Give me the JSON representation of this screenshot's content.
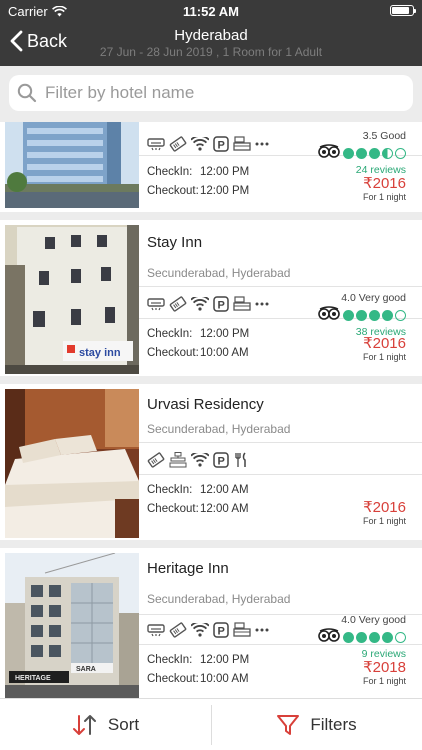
{
  "status": {
    "carrier": "Carrier",
    "time": "11:52 AM",
    "battery_level": 0.85
  },
  "nav": {
    "back_label": "Back",
    "title": "Hyderabad",
    "subtitle": "27 Jun - 28 Jun 2019 , 1 Room for 1 Adult"
  },
  "search": {
    "placeholder": "Filter by hotel name"
  },
  "hotels": [
    {
      "name": "",
      "location": "",
      "amenities": [
        "ac-icon",
        "ticket-icon",
        "wifi-icon",
        "parking-icon",
        "bed-icon",
        "more-icon"
      ],
      "rating_label": "3.5 Good",
      "rating_value": 3.5,
      "reviews": "24 reviews",
      "checkin_label": "CheckIn:",
      "checkin_time": "12:00 PM",
      "checkout_label": "Checkout:",
      "checkout_time": "12:00 PM",
      "price": "₹2016",
      "per_night": "For 1 night",
      "colors": {
        "sky": "#cfe0ef",
        "building": "#7ea3c9",
        "base": "#5a6a78"
      }
    },
    {
      "name": "Stay Inn",
      "location": "Secunderabad, Hyderabad",
      "amenities": [
        "ac-icon",
        "ticket-icon",
        "wifi-icon",
        "parking-icon",
        "bed-icon",
        "more-icon"
      ],
      "rating_label": "4.0 Very good",
      "rating_value": 4.0,
      "reviews": "38 reviews",
      "checkin_label": "CheckIn:",
      "checkin_time": "12:00 PM",
      "checkout_label": "Checkout:",
      "checkout_time": "10:00 AM",
      "price": "₹2016",
      "per_night": "For 1 night",
      "sign": "stay inn"
    },
    {
      "name": "Urvasi Residency",
      "location": "Secunderabad, Hyderabad",
      "amenities": [
        "ticket-icon",
        "elevator-icon",
        "wifi-icon",
        "parking-icon",
        "restaurant-icon"
      ],
      "checkin_label": "CheckIn:",
      "checkin_time": "12:00 AM",
      "checkout_label": "Checkout:",
      "checkout_time": "12:00 AM",
      "price": "₹2016",
      "per_night": "For 1 night"
    },
    {
      "name": "Heritage Inn",
      "location": "Secunderabad, Hyderabad",
      "amenities": [
        "ac-icon",
        "ticket-icon",
        "wifi-icon",
        "parking-icon",
        "bed-icon",
        "more-icon"
      ],
      "rating_label": "4.0 Very good",
      "rating_value": 4.0,
      "reviews": "9 reviews",
      "checkin_label": "CheckIn:",
      "checkin_time": "12:00 PM",
      "checkout_label": "Checkout:",
      "checkout_time": "10:00 AM",
      "price": "₹2018",
      "per_night": "For 1 night",
      "sign": "HERITAGE"
    }
  ],
  "bottom": {
    "sort_label": "Sort",
    "filters_label": "Filters"
  },
  "colors": {
    "topbar": "#3a3a3a",
    "price": "#d8403a",
    "tripadvisor": "#34b886",
    "accent": "#d8403a"
  }
}
